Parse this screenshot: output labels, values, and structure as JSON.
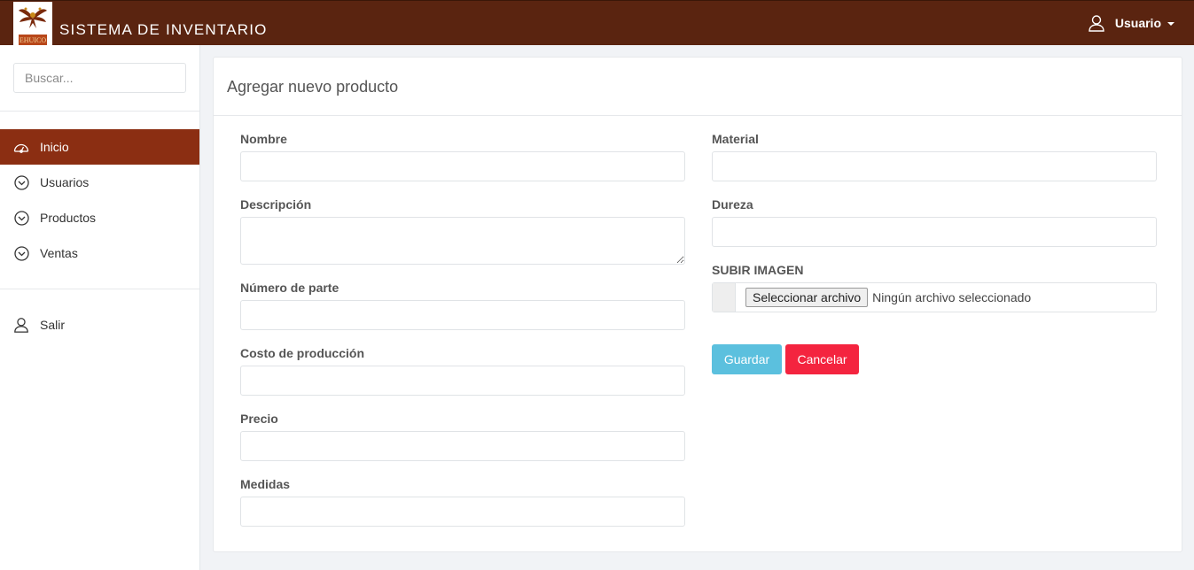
{
  "header": {
    "logo_text": "EHUICO",
    "app_title": "SISTEMA DE INVENTARIO",
    "user_label": "Usuario"
  },
  "sidebar": {
    "search_placeholder": "Buscar...",
    "items": [
      {
        "label": "Inicio",
        "icon": "dashboard-icon",
        "active": true
      },
      {
        "label": "Usuarios",
        "icon": "chevron-circle-icon"
      },
      {
        "label": "Productos",
        "icon": "chevron-circle-icon"
      },
      {
        "label": "Ventas",
        "icon": "chevron-circle-icon"
      }
    ],
    "logout": {
      "label": "Salir",
      "icon": "user-icon"
    }
  },
  "form": {
    "title": "Agregar nuevo producto",
    "fields": {
      "nombre": {
        "label": "Nombre",
        "value": ""
      },
      "descripcion": {
        "label": "Descripción",
        "value": ""
      },
      "numero_parte": {
        "label": "Número de parte",
        "value": ""
      },
      "costo": {
        "label": "Costo de producción",
        "value": ""
      },
      "precio": {
        "label": "Precio",
        "value": ""
      },
      "medidas": {
        "label": "Medidas",
        "value": ""
      },
      "material": {
        "label": "Material",
        "value": ""
      },
      "dureza": {
        "label": "Dureza",
        "value": ""
      }
    },
    "upload": {
      "label": "SUBIR IMAGEN",
      "button_label": "Seleccionar archivo",
      "status": "Ningún archivo seleccionado"
    },
    "save_label": "Guardar",
    "cancel_label": "Cancelar"
  },
  "colors": {
    "topbar": "#5a2410",
    "sidebar_active": "#8b2e12",
    "save_button": "#5bc0de",
    "cancel_button": "#f4243f"
  }
}
